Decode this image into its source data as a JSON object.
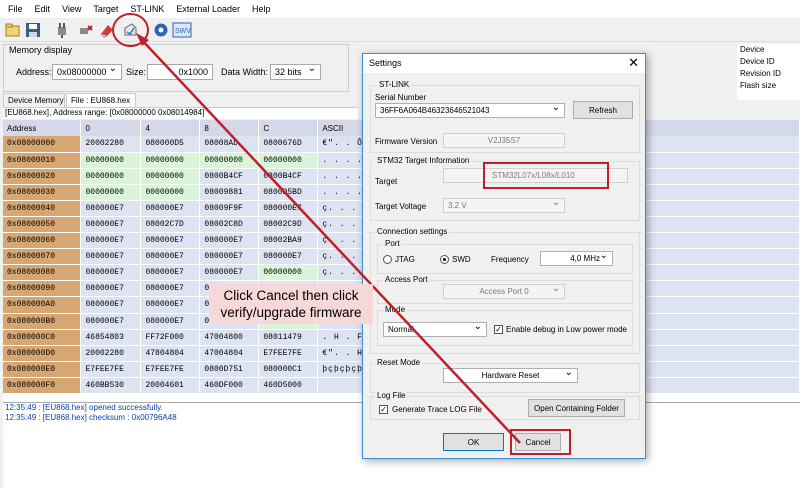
{
  "menu": [
    "File",
    "Edit",
    "View",
    "Target",
    "ST-LINK",
    "External Loader",
    "Help"
  ],
  "toolbar": {
    "icons": [
      "open-file-icon",
      "save-icon",
      "connect-icon",
      "disconnect-icon",
      "erase-icon",
      "firmware-update-icon",
      "settings-icon",
      "swv-icon"
    ],
    "swv_label": "SWV"
  },
  "memory_display": {
    "title": "Memory display",
    "address_label": "Address:",
    "address_value": "0x08000000",
    "size_label": "Size:",
    "size_value": "0x1000",
    "data_width_label": "Data Width:",
    "data_width_value": "32 bits"
  },
  "tabs": [
    "Device Memory",
    "File : EU868.hex"
  ],
  "file_info": "[EU868.hex], Address range: [0x08000000 0x08014984]",
  "device_info": [
    "Device",
    "Device ID",
    "Revision ID",
    "Flash size"
  ],
  "grid": {
    "headers": [
      "Address",
      "0",
      "4",
      "8",
      "C",
      "ASCII"
    ],
    "rows": [
      {
        "addr": "0x08000000",
        "c0": "20002280",
        "c4": "080000D5",
        "c8": "08008AD",
        "cc": "0800676D",
        "ascii": "€\".  . Õ. . .",
        "g": []
      },
      {
        "addr": "0x08000010",
        "c0": "00000000",
        "c4": "00000000",
        "c8": "00000000",
        "cc": "00000000",
        "ascii": ". . . . . . . . .",
        "g": [
          0,
          1,
          2,
          3
        ]
      },
      {
        "addr": "0x08000020",
        "c0": "00000000",
        "c4": "00000000",
        "c8": "0800B4CF",
        "cc": "0800B4CF",
        "ascii": ". . . . . . . .",
        "g": [
          0,
          1
        ]
      },
      {
        "addr": "0x08000030",
        "c0": "00000000",
        "c4": "00000000",
        "c8": "08009881",
        "cc": "0800D5BD",
        "ascii": ". . . . . . . . '",
        "g": [
          0,
          1
        ]
      },
      {
        "addr": "0x08000040",
        "c0": "080000E7",
        "c4": "080000E7",
        "c8": "08009F9F",
        "cc": "080000E7",
        "ascii": "ç. . . ç. . .",
        "g": []
      },
      {
        "addr": "0x08000050",
        "c0": "080000E7",
        "c4": "08002C7D",
        "c8": "08002C8D",
        "cc": "08002C9D",
        "ascii": "ç. . . }, . .",
        "g": []
      },
      {
        "addr": "0x08000060",
        "c0": "080000E7",
        "c4": "080000E7",
        "c8": "080000E7",
        "cc": "08002BA9",
        "ascii": "ç. . . ç. . .",
        "g": []
      },
      {
        "addr": "0x08000070",
        "c0": "080000E7",
        "c4": "080000E7",
        "c8": "080000E7",
        "cc": "080000E7",
        "ascii": "ç. . . ç. . .",
        "g": []
      },
      {
        "addr": "0x08000080",
        "c0": "080000E7",
        "c4": "080000E7",
        "c8": "080000E7",
        "cc": "00000000",
        "ascii": "ç. . . ç. . .",
        "g": [
          3
        ]
      },
      {
        "addr": "0x08000090",
        "c0": "080000E7",
        "c4": "080000E7",
        "c8": "080000E7",
        "cc": "",
        "ascii": "",
        "g": []
      },
      {
        "addr": "0x080000A0",
        "c0": "080000E7",
        "c4": "080000E7",
        "c8": "080000E7",
        "cc": "",
        "ascii": "",
        "g": []
      },
      {
        "addr": "0x080000B0",
        "c0": "080000E7",
        "c4": "080000E7",
        "c8": "08009F39",
        "cc": "00000000",
        "ascii": "",
        "g": [
          3
        ]
      },
      {
        "addr": "0x080000C0",
        "c0": "46854803",
        "c4": "FF72F000",
        "c8": "47004800",
        "cc": "08011479",
        "ascii": ". H . F . ð",
        "g": []
      },
      {
        "addr": "0x080000D0",
        "c0": "20002280",
        "c4": "47804804",
        "c8": "47004804",
        "cc": "E7FEE7FE",
        "ascii": "€\". . H€G",
        "g": []
      },
      {
        "addr": "0x080000E0",
        "c0": "E7FEE7FE",
        "c4": "E7FEE7FE",
        "c8": "0800D751",
        "cc": "080000C1",
        "ascii": "þçþçþçþç",
        "g": []
      },
      {
        "addr": "0x080000F0",
        "c0": "460BB530",
        "c4": "20004601",
        "c8": "460DF000",
        "cc": "460D5000",
        "ascii": "",
        "g": []
      }
    ]
  },
  "log": [
    "12:35:49 : [EU868.hex] opened successfully.",
    "12:35:49 : [EU868.hex] checksum : 0x00796A48"
  ],
  "dialog": {
    "title": "Settings",
    "close": "✕",
    "stlink": {
      "group": "ST-LINK",
      "serial_label": "Serial Number",
      "serial_value": "36FF6A064B46323646521043",
      "refresh": "Refresh",
      "firmware_label": "Firmware Version",
      "firmware_value": "V2J35S7"
    },
    "target_info": {
      "group": "STM32 Target Information",
      "target_label": "Target",
      "target_value": "STM32L07x/L08x/L010",
      "voltage_label": "Target Voltage",
      "voltage_value": "3.2 V"
    },
    "connection": {
      "group": "Connection settings",
      "port_group": "Port",
      "jtag": "JTAG",
      "swd": "SWD",
      "frequency_label": "Frequency",
      "frequency_value": "4,0 MHz",
      "access_port_group": "Access Port",
      "access_port_value": "Access Port 0",
      "mode_group": "Mode",
      "mode_value": "Normal",
      "debug_low_power": "Enable debug in Low power mode"
    },
    "reset": {
      "group": "Reset Mode",
      "value": "Hardware Reset"
    },
    "logfile": {
      "group": "Log File",
      "generate": "Generate Trace LOG File",
      "open_folder": "Open Containing Folder"
    },
    "ok": "OK",
    "cancel": "Cancel"
  },
  "annotation": {
    "line1": "Click Cancel then click",
    "line2": "verify/upgrade firmware",
    "color": "#c0202a"
  }
}
